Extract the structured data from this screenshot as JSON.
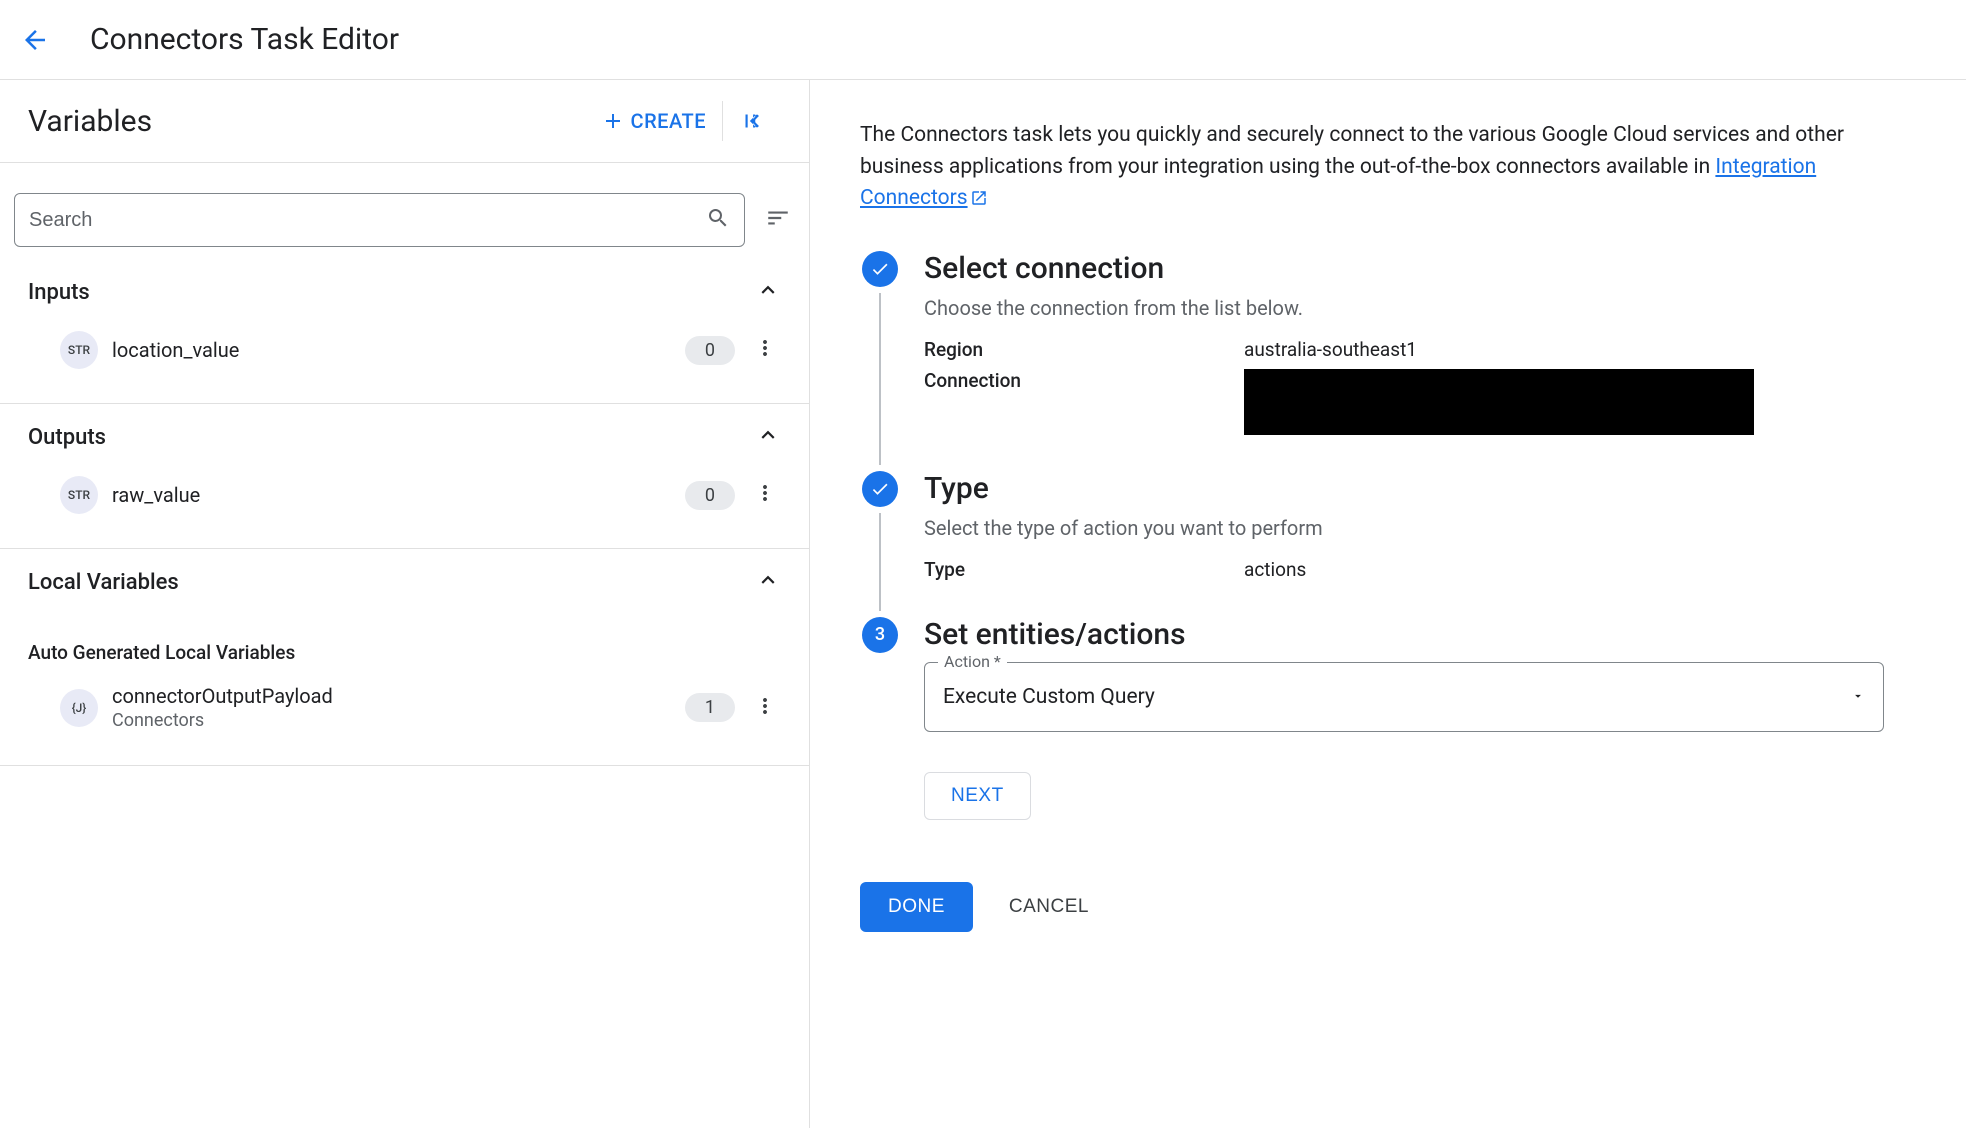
{
  "header": {
    "title": "Connectors Task Editor"
  },
  "leftPanel": {
    "title": "Variables",
    "createLabel": "CREATE",
    "searchPlaceholder": "Search",
    "sections": {
      "inputs": {
        "title": "Inputs",
        "items": [
          {
            "type": "STR",
            "name": "location_value",
            "count": "0"
          }
        ]
      },
      "outputs": {
        "title": "Outputs",
        "items": [
          {
            "type": "STR",
            "name": "raw_value",
            "count": "0"
          }
        ]
      },
      "local": {
        "title": "Local Variables",
        "autoGenLabel": "Auto Generated Local Variables",
        "items": [
          {
            "type": "{J}",
            "name": "connectorOutputPayload",
            "sub": "Connectors",
            "count": "1"
          }
        ]
      }
    }
  },
  "rightPanel": {
    "introPre": "The Connectors task lets you quickly and securely connect to the various Google Cloud services and other business applications from your integration using the out-of-the-box connectors available in ",
    "introLink": "Integration Connectors",
    "steps": {
      "s1": {
        "title": "Select connection",
        "desc": "Choose the connection from the list below.",
        "regionLabel": "Region",
        "regionValue": "australia-southeast1",
        "connectionLabel": "Connection"
      },
      "s2": {
        "title": "Type",
        "desc": "Select the type of action you want to perform",
        "typeLabel": "Type",
        "typeValue": "actions"
      },
      "s3": {
        "num": "3",
        "title": "Set entities/actions",
        "actionLabel": "Action *",
        "actionValue": "Execute Custom Query",
        "nextLabel": "NEXT"
      }
    },
    "doneLabel": "DONE",
    "cancelLabel": "CANCEL"
  }
}
